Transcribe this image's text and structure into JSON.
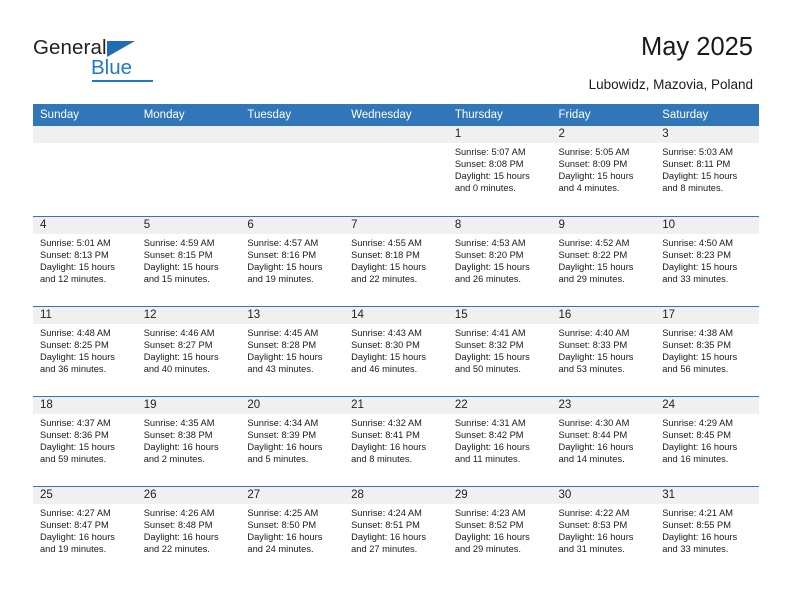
{
  "brand": {
    "word_one": "General",
    "word_two": "Blue",
    "triangle_icon": "triangle-icon",
    "accent_color": "#1f7ac4"
  },
  "header": {
    "title": "May 2025",
    "subtitle": "Lubowidz, Mazovia, Poland",
    "header_bg_color": "#3076b8",
    "daynum_bg_color": "#f0f0f0"
  },
  "weekdays": [
    "Sunday",
    "Monday",
    "Tuesday",
    "Wednesday",
    "Thursday",
    "Friday",
    "Saturday"
  ],
  "weeks": [
    [
      {
        "day": "",
        "empty": true
      },
      {
        "day": "",
        "empty": true
      },
      {
        "day": "",
        "empty": true
      },
      {
        "day": "",
        "empty": true
      },
      {
        "day": "1",
        "sunrise": "Sunrise: 5:07 AM",
        "sunset": "Sunset: 8:08 PM",
        "daylight": "Daylight: 15 hours and 0 minutes."
      },
      {
        "day": "2",
        "sunrise": "Sunrise: 5:05 AM",
        "sunset": "Sunset: 8:09 PM",
        "daylight": "Daylight: 15 hours and 4 minutes."
      },
      {
        "day": "3",
        "sunrise": "Sunrise: 5:03 AM",
        "sunset": "Sunset: 8:11 PM",
        "daylight": "Daylight: 15 hours and 8 minutes."
      }
    ],
    [
      {
        "day": "4",
        "sunrise": "Sunrise: 5:01 AM",
        "sunset": "Sunset: 8:13 PM",
        "daylight": "Daylight: 15 hours and 12 minutes."
      },
      {
        "day": "5",
        "sunrise": "Sunrise: 4:59 AM",
        "sunset": "Sunset: 8:15 PM",
        "daylight": "Daylight: 15 hours and 15 minutes."
      },
      {
        "day": "6",
        "sunrise": "Sunrise: 4:57 AM",
        "sunset": "Sunset: 8:16 PM",
        "daylight": "Daylight: 15 hours and 19 minutes."
      },
      {
        "day": "7",
        "sunrise": "Sunrise: 4:55 AM",
        "sunset": "Sunset: 8:18 PM",
        "daylight": "Daylight: 15 hours and 22 minutes."
      },
      {
        "day": "8",
        "sunrise": "Sunrise: 4:53 AM",
        "sunset": "Sunset: 8:20 PM",
        "daylight": "Daylight: 15 hours and 26 minutes."
      },
      {
        "day": "9",
        "sunrise": "Sunrise: 4:52 AM",
        "sunset": "Sunset: 8:22 PM",
        "daylight": "Daylight: 15 hours and 29 minutes."
      },
      {
        "day": "10",
        "sunrise": "Sunrise: 4:50 AM",
        "sunset": "Sunset: 8:23 PM",
        "daylight": "Daylight: 15 hours and 33 minutes."
      }
    ],
    [
      {
        "day": "11",
        "sunrise": "Sunrise: 4:48 AM",
        "sunset": "Sunset: 8:25 PM",
        "daylight": "Daylight: 15 hours and 36 minutes."
      },
      {
        "day": "12",
        "sunrise": "Sunrise: 4:46 AM",
        "sunset": "Sunset: 8:27 PM",
        "daylight": "Daylight: 15 hours and 40 minutes."
      },
      {
        "day": "13",
        "sunrise": "Sunrise: 4:45 AM",
        "sunset": "Sunset: 8:28 PM",
        "daylight": "Daylight: 15 hours and 43 minutes."
      },
      {
        "day": "14",
        "sunrise": "Sunrise: 4:43 AM",
        "sunset": "Sunset: 8:30 PM",
        "daylight": "Daylight: 15 hours and 46 minutes."
      },
      {
        "day": "15",
        "sunrise": "Sunrise: 4:41 AM",
        "sunset": "Sunset: 8:32 PM",
        "daylight": "Daylight: 15 hours and 50 minutes."
      },
      {
        "day": "16",
        "sunrise": "Sunrise: 4:40 AM",
        "sunset": "Sunset: 8:33 PM",
        "daylight": "Daylight: 15 hours and 53 minutes."
      },
      {
        "day": "17",
        "sunrise": "Sunrise: 4:38 AM",
        "sunset": "Sunset: 8:35 PM",
        "daylight": "Daylight: 15 hours and 56 minutes."
      }
    ],
    [
      {
        "day": "18",
        "sunrise": "Sunrise: 4:37 AM",
        "sunset": "Sunset: 8:36 PM",
        "daylight": "Daylight: 15 hours and 59 minutes."
      },
      {
        "day": "19",
        "sunrise": "Sunrise: 4:35 AM",
        "sunset": "Sunset: 8:38 PM",
        "daylight": "Daylight: 16 hours and 2 minutes."
      },
      {
        "day": "20",
        "sunrise": "Sunrise: 4:34 AM",
        "sunset": "Sunset: 8:39 PM",
        "daylight": "Daylight: 16 hours and 5 minutes."
      },
      {
        "day": "21",
        "sunrise": "Sunrise: 4:32 AM",
        "sunset": "Sunset: 8:41 PM",
        "daylight": "Daylight: 16 hours and 8 minutes."
      },
      {
        "day": "22",
        "sunrise": "Sunrise: 4:31 AM",
        "sunset": "Sunset: 8:42 PM",
        "daylight": "Daylight: 16 hours and 11 minutes."
      },
      {
        "day": "23",
        "sunrise": "Sunrise: 4:30 AM",
        "sunset": "Sunset: 8:44 PM",
        "daylight": "Daylight: 16 hours and 14 minutes."
      },
      {
        "day": "24",
        "sunrise": "Sunrise: 4:29 AM",
        "sunset": "Sunset: 8:45 PM",
        "daylight": "Daylight: 16 hours and 16 minutes."
      }
    ],
    [
      {
        "day": "25",
        "sunrise": "Sunrise: 4:27 AM",
        "sunset": "Sunset: 8:47 PM",
        "daylight": "Daylight: 16 hours and 19 minutes."
      },
      {
        "day": "26",
        "sunrise": "Sunrise: 4:26 AM",
        "sunset": "Sunset: 8:48 PM",
        "daylight": "Daylight: 16 hours and 22 minutes."
      },
      {
        "day": "27",
        "sunrise": "Sunrise: 4:25 AM",
        "sunset": "Sunset: 8:50 PM",
        "daylight": "Daylight: 16 hours and 24 minutes."
      },
      {
        "day": "28",
        "sunrise": "Sunrise: 4:24 AM",
        "sunset": "Sunset: 8:51 PM",
        "daylight": "Daylight: 16 hours and 27 minutes."
      },
      {
        "day": "29",
        "sunrise": "Sunrise: 4:23 AM",
        "sunset": "Sunset: 8:52 PM",
        "daylight": "Daylight: 16 hours and 29 minutes."
      },
      {
        "day": "30",
        "sunrise": "Sunrise: 4:22 AM",
        "sunset": "Sunset: 8:53 PM",
        "daylight": "Daylight: 16 hours and 31 minutes."
      },
      {
        "day": "31",
        "sunrise": "Sunrise: 4:21 AM",
        "sunset": "Sunset: 8:55 PM",
        "daylight": "Daylight: 16 hours and 33 minutes."
      }
    ]
  ]
}
